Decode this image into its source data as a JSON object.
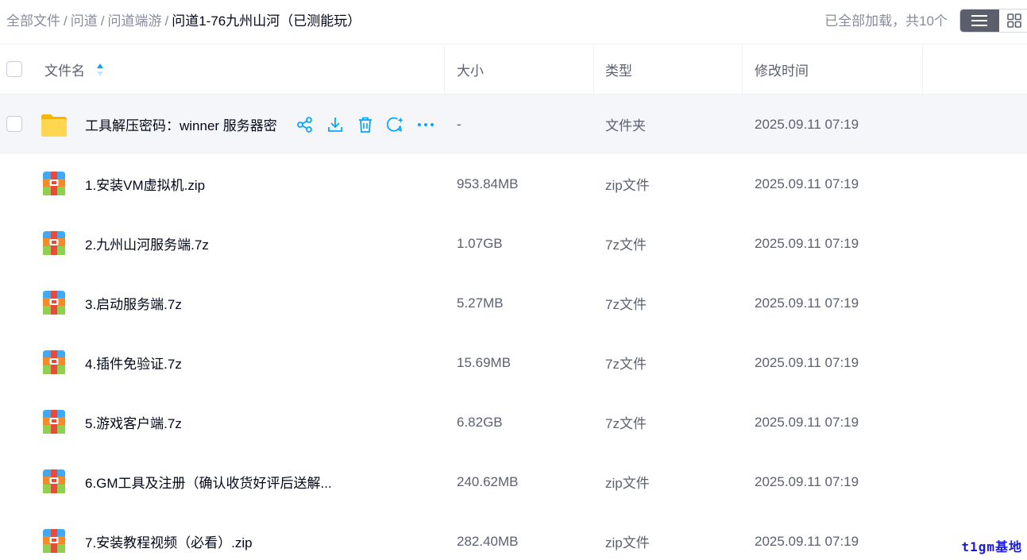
{
  "breadcrumb": {
    "items": [
      "全部文件",
      "问道",
      "问道端游"
    ],
    "separator": "/",
    "current": "问道1-76九州山河（已测能玩）"
  },
  "load_status": "已全部加载，共10个",
  "view_toggle": {
    "active": "list-view-icon",
    "inactive": "grid-view-icon"
  },
  "columns": {
    "name": "文件名",
    "size": "大小",
    "type": "类型",
    "modified": "修改时间"
  },
  "files": [
    {
      "name": "工具解压密码：winner 服务器密",
      "size": "-",
      "type": "文件夹",
      "modified": "2025.09.11 07:19",
      "icon": "folder-icon"
    },
    {
      "name": "1.安装VM虚拟机.zip",
      "size": "953.84MB",
      "type": "zip文件",
      "modified": "2025.09.11 07:19",
      "icon": "archive-icon"
    },
    {
      "name": "2.九州山河服务端.7z",
      "size": "1.07GB",
      "type": "7z文件",
      "modified": "2025.09.11 07:19",
      "icon": "archive-icon"
    },
    {
      "name": "3.启动服务端.7z",
      "size": "5.27MB",
      "type": "7z文件",
      "modified": "2025.09.11 07:19",
      "icon": "archive-icon"
    },
    {
      "name": "4.插件免验证.7z",
      "size": "15.69MB",
      "type": "7z文件",
      "modified": "2025.09.11 07:19",
      "icon": "archive-icon"
    },
    {
      "name": "5.游戏客户端.7z",
      "size": "6.82GB",
      "type": "7z文件",
      "modified": "2025.09.11 07:19",
      "icon": "archive-icon"
    },
    {
      "name": "6.GM工具及注册（确认收货好评后送解...",
      "size": "240.62MB",
      "type": "zip文件",
      "modified": "2025.09.11 07:19",
      "icon": "archive-icon"
    },
    {
      "name": "7.安装教程视频（必看）.zip",
      "size": "282.40MB",
      "type": "zip文件",
      "modified": "2025.09.11 07:19",
      "icon": "archive-icon"
    }
  ],
  "row_actions": [
    "share-icon",
    "download-icon",
    "delete-icon",
    "ai-chat-icon",
    "more-icon"
  ],
  "watermark": "t1gm基地",
  "colors": {
    "accent": "#06a7ff",
    "hover_row": "#f5f6fa",
    "text_primary": "#03081a",
    "text_secondary": "#5c6170"
  }
}
